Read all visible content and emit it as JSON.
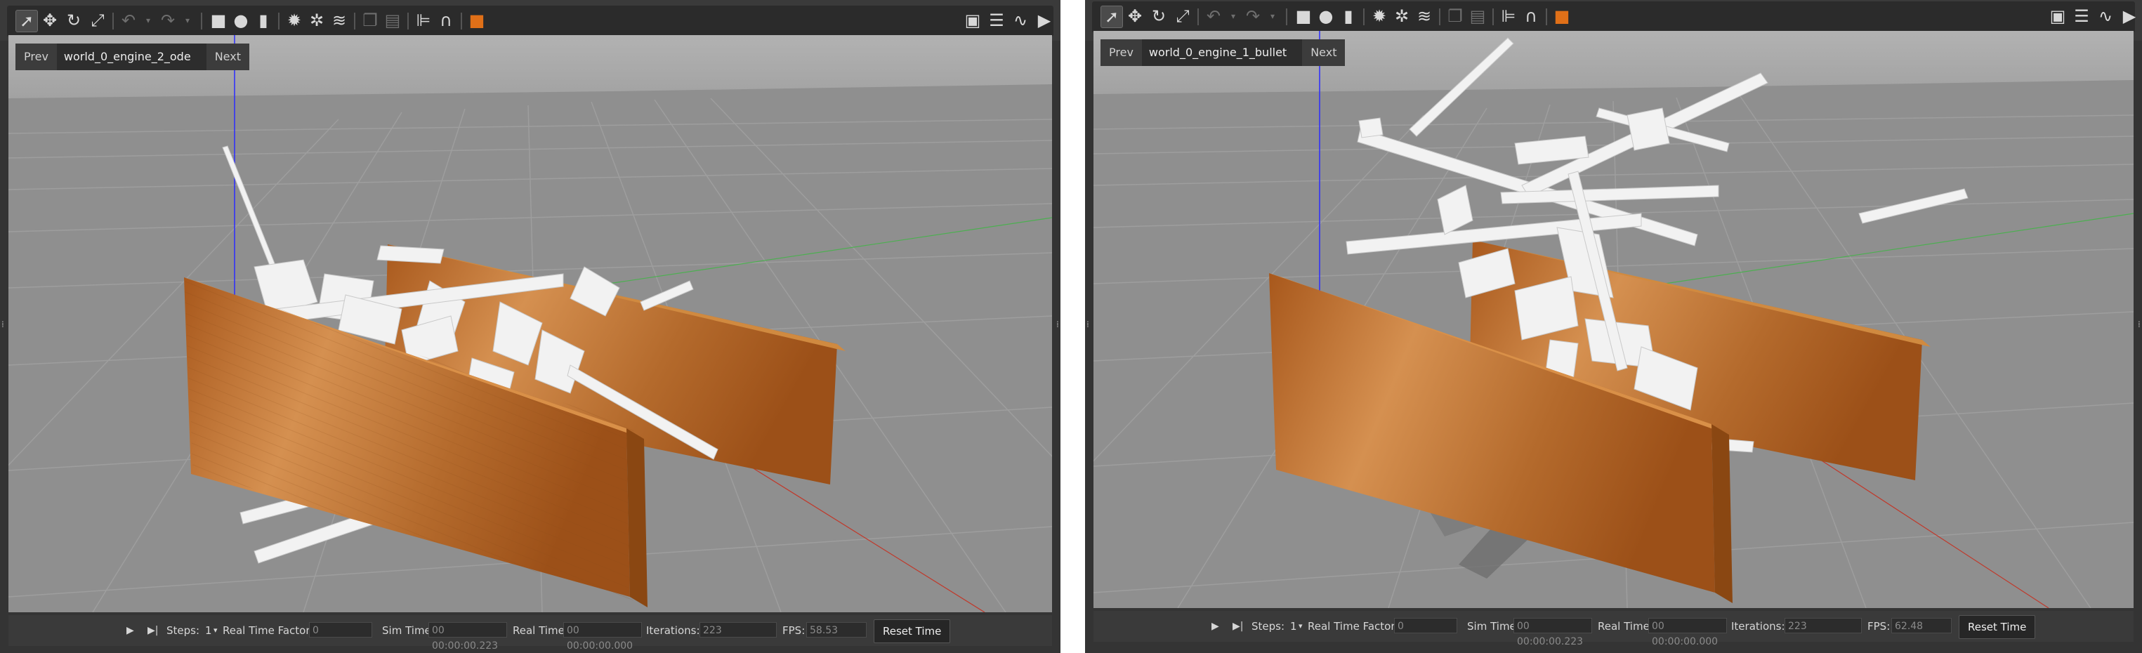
{
  "colors": {
    "wood": "#b86a28",
    "wood_edge": "#8e4a14",
    "floor": "#8e8e8e",
    "sky": "#a8a8a8",
    "grid": "#9c9c9c",
    "panel": "#3a3a3a",
    "accent": "#e07018"
  },
  "toolbar_icons": [
    "select-arrow-icon",
    "translate-icon",
    "rotate-icon",
    "scale-icon",
    "undo-icon",
    "undo-dropdown-icon",
    "redo-icon",
    "redo-dropdown-icon",
    "box-icon",
    "sphere-icon",
    "cylinder-icon",
    "point-light-icon",
    "spot-light-icon",
    "directional-light-icon",
    "copy-icon",
    "paste-icon",
    "align-icon",
    "snap-icon",
    "view-angle-icon",
    "screenshot-icon",
    "log-icon",
    "plot-icon",
    "video-record-icon"
  ],
  "left": {
    "nav": {
      "prev": "Prev",
      "world": "world_0_engine_2_ode",
      "next": "Next"
    },
    "status": {
      "steps_label": "Steps:",
      "steps_value": "1",
      "rtf_label": "Real Time Factor:",
      "rtf_value": "0",
      "sim_label": "Sim Time:",
      "sim_value": "00 00:00:00.223",
      "real_label": "Real Time:",
      "real_value": "00 00:00:00.000",
      "iter_label": "Iterations:",
      "iter_value": "223",
      "fps_label": "FPS:",
      "fps_value": "58.53",
      "reset": "Reset Time"
    }
  },
  "right": {
    "nav": {
      "prev": "Prev",
      "world": "world_0_engine_1_bullet",
      "next": "Next"
    },
    "status": {
      "steps_label": "Steps:",
      "steps_value": "1",
      "rtf_label": "Real Time Factor:",
      "rtf_value": "0",
      "sim_label": "Sim Time:",
      "sim_value": "00 00:00:00.223",
      "real_label": "Real Time:",
      "real_value": "00 00:00:00.000",
      "iter_label": "Iterations:",
      "iter_value": "223",
      "fps_label": "FPS:",
      "fps_value": "62.48",
      "reset": "Reset Time"
    }
  }
}
